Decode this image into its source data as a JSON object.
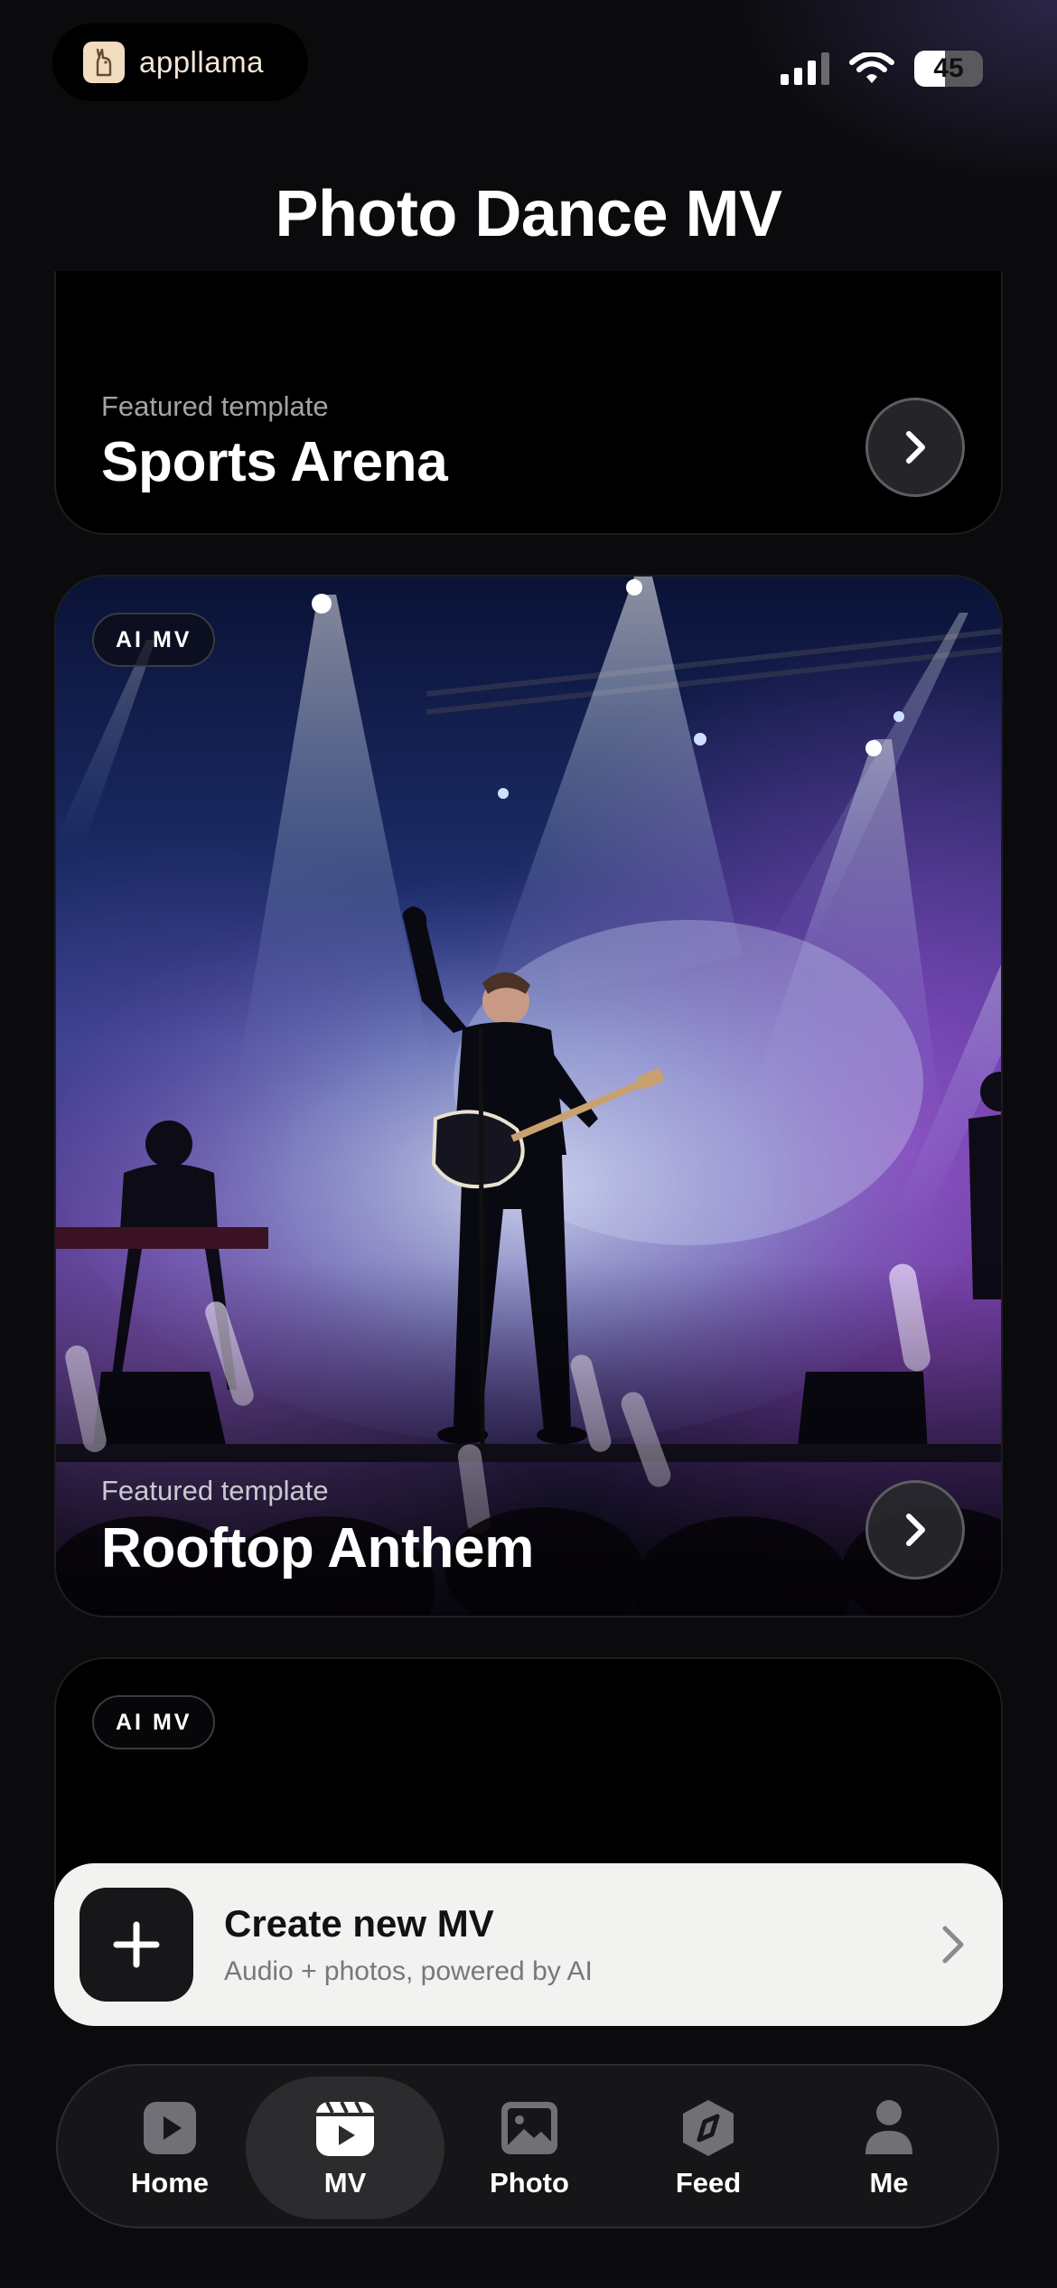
{
  "status": {
    "brand": "appllama",
    "battery": "45",
    "battery_fraction": 0.45
  },
  "header": {
    "title": "Photo Dance MV"
  },
  "cards": [
    {
      "eyebrow": "Featured template",
      "title": "Sports Arena"
    },
    {
      "badge": "AI MV",
      "eyebrow": "Featured template",
      "title": "Rooftop Anthem"
    },
    {
      "badge": "AI MV"
    }
  ],
  "create": {
    "title": "Create new MV",
    "subtitle": "Audio + photos, powered by AI"
  },
  "tabs": [
    {
      "label": "Home",
      "icon": "play-square-icon"
    },
    {
      "label": "MV",
      "icon": "clapperboard-icon",
      "active": true
    },
    {
      "label": "Photo",
      "icon": "image-icon"
    },
    {
      "label": "Feed",
      "icon": "compass-icon"
    },
    {
      "label": "Me",
      "icon": "person-icon"
    }
  ],
  "colors": {
    "background": "#0b0b0d",
    "card": "#000000",
    "create_bar": "#f2f2f0",
    "tab_active": "#2c2c2f"
  }
}
